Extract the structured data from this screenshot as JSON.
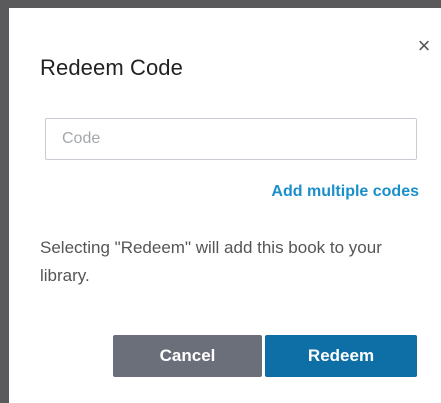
{
  "dialog": {
    "title": "Redeem Code",
    "close_label": "×",
    "code_input": {
      "placeholder": "Code",
      "value": ""
    },
    "add_multiple_label": "Add multiple codes",
    "info_text": "Selecting \"Redeem\" will add this book to your library.",
    "cancel_label": "Cancel",
    "redeem_label": "Redeem"
  },
  "colors": {
    "backdrop": "#5a5a5c",
    "link": "#1a8fc9",
    "cancel_button": "#6b6f7a",
    "redeem_button": "#0e6fa6"
  }
}
